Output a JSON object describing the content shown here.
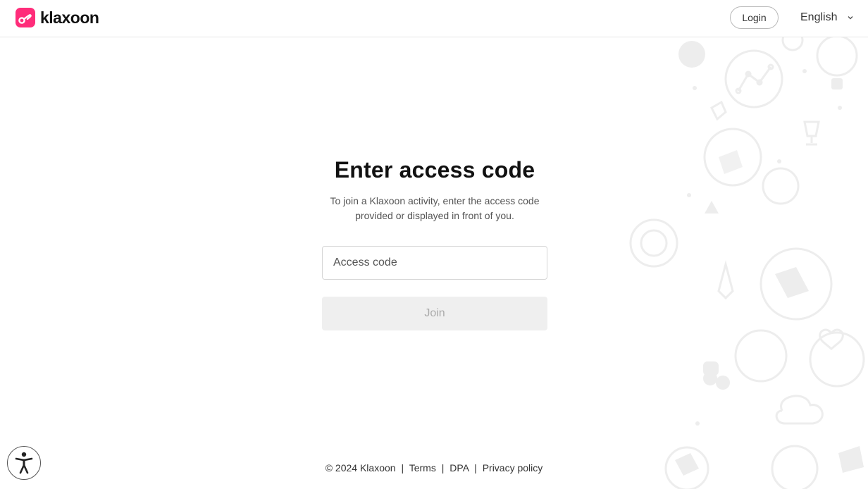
{
  "header": {
    "logo_text": "klaxoon",
    "login_label": "Login",
    "language": "English"
  },
  "main": {
    "title": "Enter access code",
    "subtitle_line1": "To join a Klaxoon activity, enter the access code",
    "subtitle_line2": "provided or displayed in front of you.",
    "access_code_placeholder": "Access code",
    "access_code_value": "",
    "join_label": "Join"
  },
  "footer": {
    "copyright": "© 2024 Klaxoon",
    "separator": "|",
    "terms": "Terms",
    "dpa": "DPA",
    "privacy": "Privacy policy"
  },
  "colors": {
    "brand": "#ff2d7a",
    "join_disabled_bg": "#efefef",
    "join_disabled_text": "#aaaaaa",
    "decor": "#ededed"
  },
  "icons": {
    "logo": "klaxoon-logo-icon",
    "chevron": "chevron-down-icon",
    "accessibility": "accessibility-icon"
  }
}
